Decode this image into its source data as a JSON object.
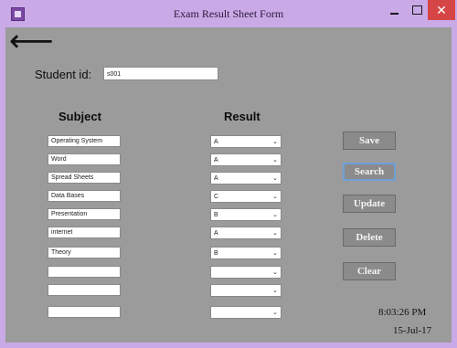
{
  "window": {
    "title": "Exam Result Sheet Form",
    "minimize_icon": "minimize-icon",
    "maximize_icon": "maximize-icon",
    "close_icon": "close-icon",
    "close_glyph": "✕"
  },
  "nav": {
    "back_icon": "left-arrow-icon",
    "back_glyph": "⟵"
  },
  "form": {
    "student_id_label": "Student id:",
    "student_id_value": "s001",
    "subject_header": "Subject",
    "result_header": "Result"
  },
  "rows": [
    {
      "subject": "Operating System",
      "result": "A"
    },
    {
      "subject": "Word",
      "result": "A"
    },
    {
      "subject": "Spread Sheets",
      "result": "A"
    },
    {
      "subject": "Data Bases",
      "result": "C"
    },
    {
      "subject": "Presentation",
      "result": "B"
    },
    {
      "subject": "internet",
      "result": "A"
    },
    {
      "subject": "Theory",
      "result": "B"
    },
    {
      "subject": "",
      "result": ""
    },
    {
      "subject": "",
      "result": ""
    },
    {
      "subject": "",
      "result": ""
    }
  ],
  "buttons": {
    "save": "Save",
    "search": "Search",
    "update": "Update",
    "delete": "Delete",
    "clear": "Clear"
  },
  "status": {
    "time": "8:03:26 PM",
    "date": "15-Jul-17"
  },
  "colors": {
    "window_frame": "#c9a9e6",
    "client_bg": "#9b9b9b",
    "button_bg": "#8b8b8b",
    "close_red": "#d64545"
  }
}
